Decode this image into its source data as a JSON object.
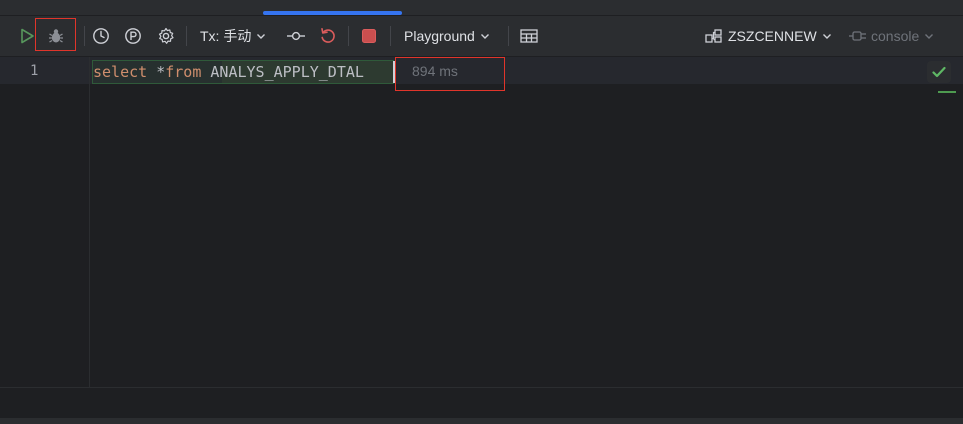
{
  "toolbar": {
    "tx_label": "Tx: 手动",
    "schema_label": "Playground",
    "datasource_label": "ZSZCENNEW",
    "session_label": "console"
  },
  "icons": {
    "run": "run-icon",
    "debug": "bug-icon",
    "history": "clock-icon",
    "explain": "p-circle-icon",
    "settings": "gear-icon",
    "commit": "commit-icon",
    "rollback": "rollback-icon",
    "stop": "stop-icon",
    "table": "table-icon",
    "datasource": "datasource-icon",
    "console": "console-icon",
    "check": "check-icon"
  },
  "editor": {
    "line_number": "1",
    "kw_select": "select",
    "star": "*",
    "kw_from": "from",
    "table_name": "ANALYS_APPLY_DTAL",
    "exec_time": "894 ms"
  },
  "colors": {
    "accent": "#3574f0",
    "keyword": "#cf8e6d",
    "highlight_box": "#e0352b",
    "success": "#4e9a50"
  }
}
